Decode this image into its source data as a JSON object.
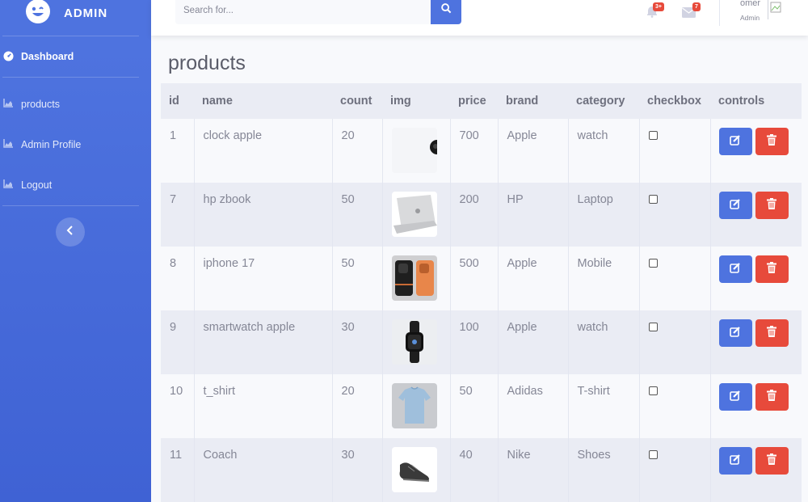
{
  "sidebar": {
    "brand": "ADMIN",
    "items": [
      {
        "label": "Dashboard",
        "icon": "dashboard-icon"
      },
      {
        "label": "products",
        "icon": "chart-area-icon"
      },
      {
        "label": "Admin Profile",
        "icon": "chart-area-icon"
      },
      {
        "label": "Logout",
        "icon": "chart-area-icon"
      }
    ]
  },
  "topbar": {
    "search_placeholder": "Search for...",
    "alerts_badge": "3+",
    "messages_badge": "7",
    "user_name": "omer",
    "user_role": "Admin"
  },
  "page": {
    "title": "products"
  },
  "table": {
    "headers": [
      "id",
      "name",
      "count",
      "img",
      "price",
      "brand",
      "category",
      "checkbox",
      "controls"
    ],
    "rows": [
      {
        "id": "1",
        "name": "clock apple",
        "count": "20",
        "img": "clock-image",
        "price": "700",
        "brand": "Apple",
        "category": "watch"
      },
      {
        "id": "7",
        "name": "hp zbook",
        "count": "50",
        "img": "laptop-image",
        "price": "200",
        "brand": "HP",
        "category": "Laptop"
      },
      {
        "id": "8",
        "name": "iphone 17",
        "count": "50",
        "img": "phone-image",
        "price": "500",
        "brand": "Apple",
        "category": "Mobile"
      },
      {
        "id": "9",
        "name": "smartwatch apple",
        "count": "30",
        "img": "smartwatch-image",
        "price": "100",
        "brand": "Apple",
        "category": "watch"
      },
      {
        "id": "10",
        "name": "t_shirt",
        "count": "20",
        "img": "tshirt-image",
        "price": "50",
        "brand": "Adidas",
        "category": "T-shirt"
      },
      {
        "id": "11",
        "name": "Coach",
        "count": "30",
        "img": "shoe-image",
        "price": "40",
        "brand": "Nike",
        "category": "Shoes"
      }
    ]
  },
  "colors": {
    "primary": "#4e73df",
    "danger": "#e74a3b",
    "text": "#858796"
  }
}
